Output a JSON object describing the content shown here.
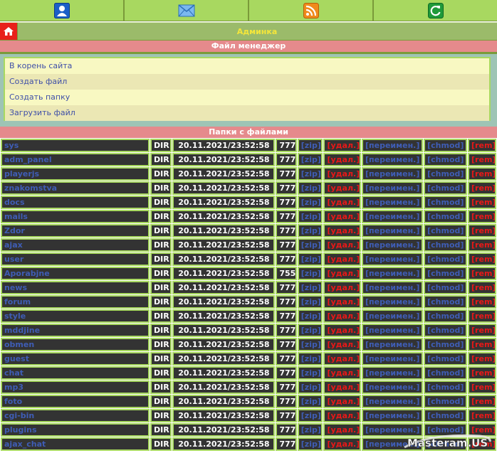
{
  "topbar": {
    "icons": [
      "user-icon",
      "mail-icon",
      "rss-icon",
      "refresh-icon"
    ]
  },
  "admin": {
    "title": "Админка"
  },
  "file_manager": {
    "header": "Файл менеджер",
    "items": [
      {
        "label": "В корень сайта"
      },
      {
        "label": "Создать файл"
      },
      {
        "label": "Создать папку"
      },
      {
        "label": "Загрузить файл"
      }
    ]
  },
  "files": {
    "header": "Папки с файлами",
    "actions": {
      "zip": "[zip]",
      "delete": "[удал.]",
      "rename": "[переимен.]",
      "chmod": "[chmod]",
      "rem": "[rem]"
    },
    "rows": [
      {
        "name": "sys",
        "type": "DIR",
        "date": "20.11.2021/23:52:58",
        "perm": "777"
      },
      {
        "name": "adm_panel",
        "type": "DIR",
        "date": "20.11.2021/23:52:58",
        "perm": "777"
      },
      {
        "name": "playerjs",
        "type": "DIR",
        "date": "20.11.2021/23:52:58",
        "perm": "777"
      },
      {
        "name": "znakomstva",
        "type": "DIR",
        "date": "20.11.2021/23:52:58",
        "perm": "777"
      },
      {
        "name": "docs",
        "type": "DIR",
        "date": "20.11.2021/23:52:58",
        "perm": "777"
      },
      {
        "name": "mails",
        "type": "DIR",
        "date": "20.11.2021/23:52:58",
        "perm": "777"
      },
      {
        "name": "Zdor",
        "type": "DIR",
        "date": "20.11.2021/23:52:58",
        "perm": "777"
      },
      {
        "name": "ajax",
        "type": "DIR",
        "date": "20.11.2021/23:52:58",
        "perm": "777"
      },
      {
        "name": "user",
        "type": "DIR",
        "date": "20.11.2021/23:52:58",
        "perm": "777"
      },
      {
        "name": "Aporabjne",
        "type": "DIR",
        "date": "20.11.2021/23:52:58",
        "perm": "755"
      },
      {
        "name": "news",
        "type": "DIR",
        "date": "20.11.2021/23:52:58",
        "perm": "777"
      },
      {
        "name": "forum",
        "type": "DIR",
        "date": "20.11.2021/23:52:58",
        "perm": "777"
      },
      {
        "name": "style",
        "type": "DIR",
        "date": "20.11.2021/23:52:58",
        "perm": "777"
      },
      {
        "name": "mddjine",
        "type": "DIR",
        "date": "20.11.2021/23:52:58",
        "perm": "777"
      },
      {
        "name": "obmen",
        "type": "DIR",
        "date": "20.11.2021/23:52:58",
        "perm": "777"
      },
      {
        "name": "guest",
        "type": "DIR",
        "date": "20.11.2021/23:52:58",
        "perm": "777"
      },
      {
        "name": "chat",
        "type": "DIR",
        "date": "20.11.2021/23:52:58",
        "perm": "777"
      },
      {
        "name": "mp3",
        "type": "DIR",
        "date": "20.11.2021/23:52:58",
        "perm": "777"
      },
      {
        "name": "foto",
        "type": "DIR",
        "date": "20.11.2021/23:52:58",
        "perm": "777"
      },
      {
        "name": "cgi-bin",
        "type": "DIR",
        "date": "20.11.2021/23:52:58",
        "perm": "777"
      },
      {
        "name": "plugins",
        "type": "DIR",
        "date": "20.11.2021/23:52:58",
        "perm": "777"
      },
      {
        "name": "ajax_chat",
        "type": "DIR",
        "date": "20.11.2021/23:52:58",
        "perm": "777"
      }
    ]
  },
  "watermark": {
    "text": "Masteram.US"
  },
  "colors": {
    "topbar": "#a8d860",
    "admin_bar": "#9bbb6a",
    "admin_title": "#f5e63a",
    "section_header": "#e58a8c",
    "link": "#3f5db5",
    "danger": "#e81818",
    "cell_bg": "#333333",
    "cell_border": "#a8d860"
  }
}
